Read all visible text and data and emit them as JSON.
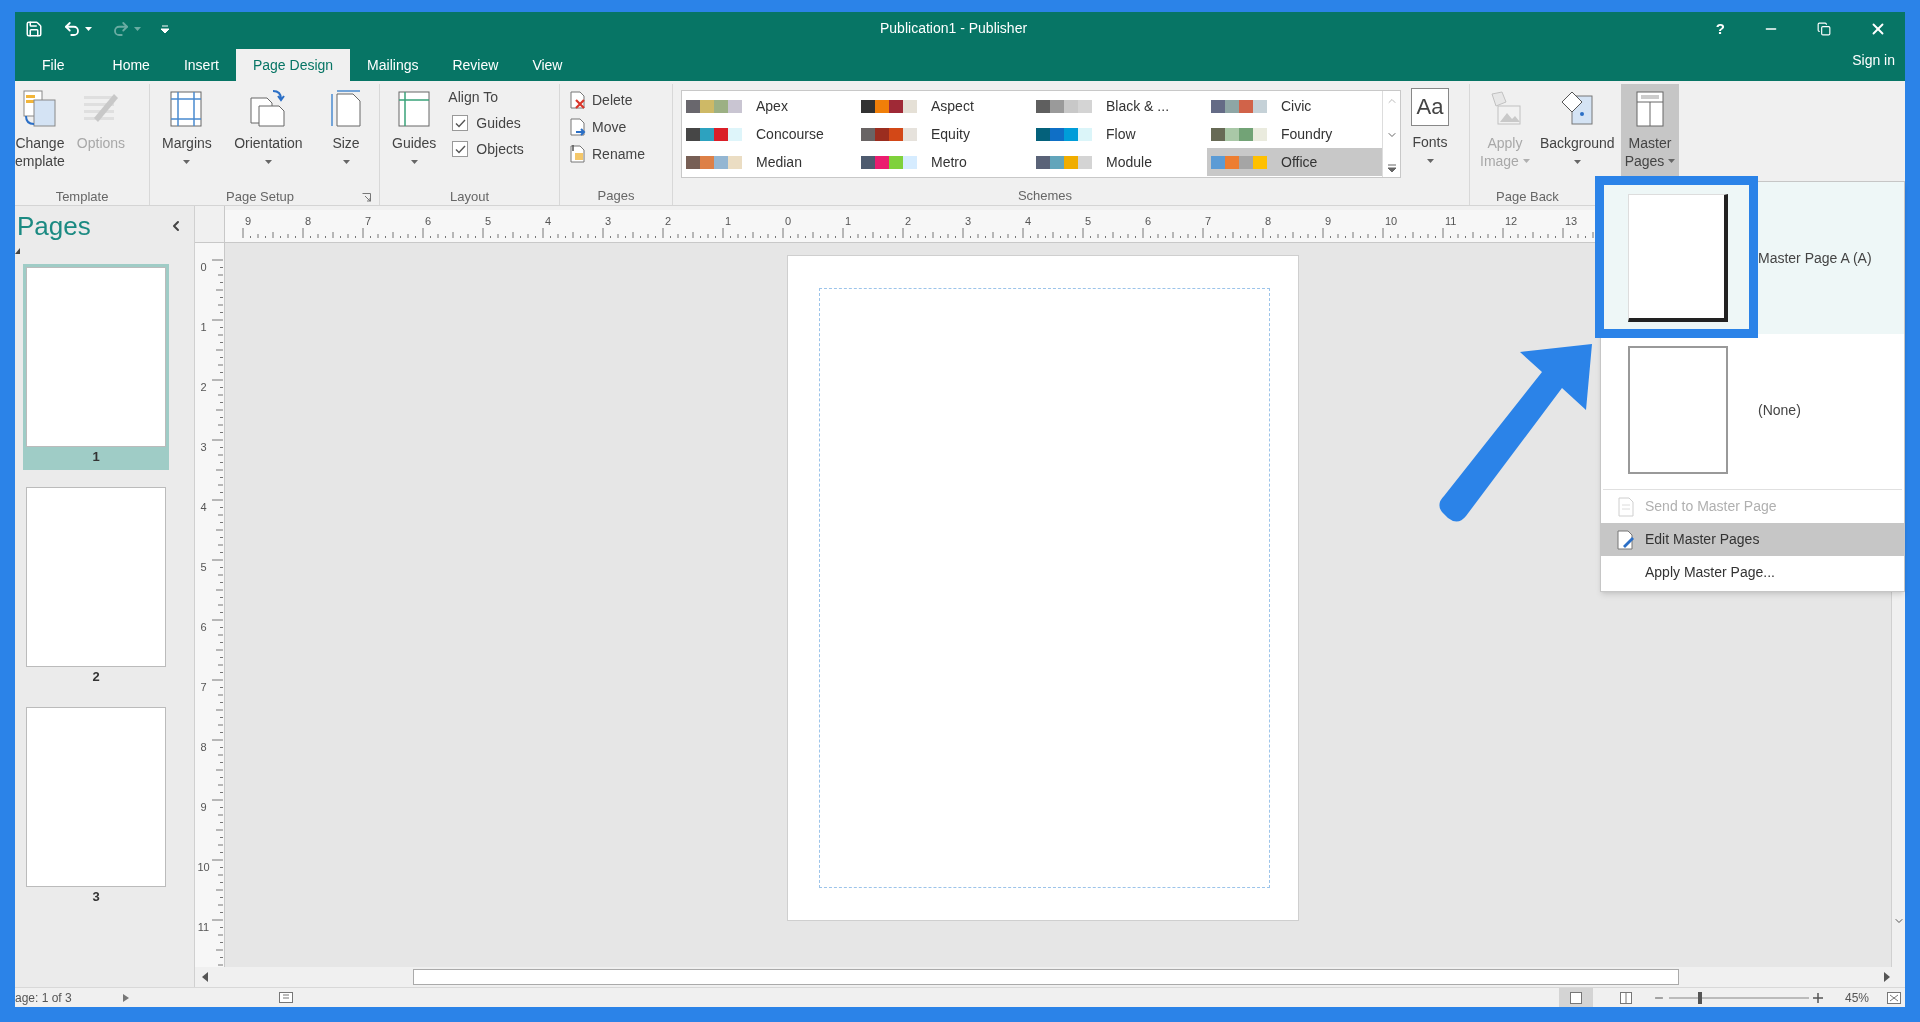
{
  "window": {
    "title": "Publication1 - Publisher",
    "help": "?"
  },
  "tabs": [
    {
      "label": "File",
      "selected": false
    },
    {
      "label": "Home",
      "selected": false
    },
    {
      "label": "Insert",
      "selected": false
    },
    {
      "label": "Page Design",
      "selected": true
    },
    {
      "label": "Mailings",
      "selected": false
    },
    {
      "label": "Review",
      "selected": false
    },
    {
      "label": "View",
      "selected": false
    }
  ],
  "sign_in": "Sign in",
  "ribbon": {
    "template": {
      "label": "Template",
      "buttons": [
        {
          "lines": [
            "Change",
            "emplate"
          ],
          "disabled": false,
          "dropdown": false
        },
        {
          "lines": [
            "Options"
          ],
          "disabled": true,
          "dropdown": false
        }
      ]
    },
    "page_setup": {
      "label": "Page Setup",
      "buttons": [
        {
          "lines": [
            "Margins"
          ],
          "disabled": false,
          "dropdown": true
        },
        {
          "lines": [
            "Orientation"
          ],
          "disabled": false,
          "dropdown": true
        },
        {
          "lines": [
            "Size"
          ],
          "disabled": false,
          "dropdown": true
        }
      ]
    },
    "layout": {
      "label": "Layout",
      "buttons": [
        {
          "lines": [
            "Guides"
          ],
          "disabled": false,
          "dropdown": true
        }
      ],
      "align_to": "Align To",
      "checks": [
        {
          "label": "Guides",
          "checked": true
        },
        {
          "label": "Objects",
          "checked": true
        }
      ]
    },
    "pages": {
      "label": "Pages",
      "buttons": [
        {
          "label": "Delete"
        },
        {
          "label": "Move"
        },
        {
          "label": "Rename"
        }
      ]
    },
    "schemes": {
      "label": "Schemes",
      "items": [
        {
          "name": "Apex",
          "selected": false,
          "swatches": [
            {
              "color": "#69676d"
            },
            {
              "color": "#ceb966"
            },
            {
              "color": "#9cb084"
            },
            {
              "color": "#c9c5d2"
            }
          ]
        },
        {
          "name": "Aspect",
          "selected": false,
          "swatches": [
            {
              "color": "#323232"
            },
            {
              "color": "#f07f09"
            },
            {
              "color": "#9f2936"
            },
            {
              "color": "#e5e0d6"
            }
          ]
        },
        {
          "name": "Black & ...",
          "selected": false,
          "swatches": [
            {
              "color": "#5f5f5f"
            },
            {
              "color": "#9a9a9a"
            },
            {
              "color": "#c8c8c8"
            },
            {
              "color": "#d4d4d4"
            }
          ]
        },
        {
          "name": "Civic",
          "selected": false,
          "swatches": [
            {
              "color": "#646b86"
            },
            {
              "color": "#8ea6a5"
            },
            {
              "color": "#d16349"
            },
            {
              "color": "#c5d1d7"
            }
          ]
        },
        {
          "name": "Concourse",
          "selected": false,
          "swatches": [
            {
              "color": "#464646"
            },
            {
              "color": "#2da2bf"
            },
            {
              "color": "#da1f28"
            },
            {
              "color": "#def5fa"
            }
          ]
        },
        {
          "name": "Equity",
          "selected": false,
          "swatches": [
            {
              "color": "#696464"
            },
            {
              "color": "#9b2d1f"
            },
            {
              "color": "#d34817"
            },
            {
              "color": "#e6e2dc"
            }
          ]
        },
        {
          "name": "Flow",
          "selected": false,
          "swatches": [
            {
              "color": "#04617b"
            },
            {
              "color": "#0f6fc6"
            },
            {
              "color": "#009dd9"
            },
            {
              "color": "#dbf5f9"
            }
          ]
        },
        {
          "name": "Foundry",
          "selected": false,
          "swatches": [
            {
              "color": "#676a55"
            },
            {
              "color": "#a9c8a7"
            },
            {
              "color": "#72a376"
            },
            {
              "color": "#eaebde"
            }
          ]
        },
        {
          "name": "Median",
          "selected": false,
          "swatches": [
            {
              "color": "#775f55"
            },
            {
              "color": "#dd8047"
            },
            {
              "color": "#94b6d2"
            },
            {
              "color": "#ebddc3"
            }
          ]
        },
        {
          "name": "Metro",
          "selected": false,
          "swatches": [
            {
              "color": "#4e5b6f"
            },
            {
              "color": "#eb1d6f"
            },
            {
              "color": "#7fd13b"
            },
            {
              "color": "#d6ecff"
            }
          ]
        },
        {
          "name": "Module",
          "selected": false,
          "swatches": [
            {
              "color": "#5a6378"
            },
            {
              "color": "#62a5bb"
            },
            {
              "color": "#f0ad00"
            },
            {
              "color": "#d4d4d4"
            }
          ]
        },
        {
          "name": "Office",
          "selected": true,
          "swatches": [
            {
              "color": "#5b9bd5"
            },
            {
              "color": "#ed7d31"
            },
            {
              "color": "#a5a5a5"
            },
            {
              "color": "#ffc000"
            }
          ]
        }
      ],
      "fonts": {
        "glyph": "Aa",
        "lines": [
          "Fonts"
        ],
        "disabled": false,
        "dropdown": true
      }
    },
    "page_background": {
      "label": "Page Back",
      "buttons": [
        {
          "lines": [
            "Apply",
            "Image"
          ],
          "disabled": true,
          "dropdown": true,
          "selected": false
        },
        {
          "lines": [
            "Background"
          ],
          "disabled": false,
          "dropdown": true,
          "selected": false
        },
        {
          "lines": [
            "Master",
            "Pages"
          ],
          "disabled": false,
          "dropdown": true,
          "selected": true
        }
      ]
    }
  },
  "pages_panel": {
    "title": "Pages",
    "pages": [
      {
        "number": "1",
        "selected": true
      },
      {
        "number": "2",
        "selected": false
      },
      {
        "number": "3",
        "selected": false
      }
    ]
  },
  "horizontal_ruler": [
    "9",
    "8",
    "7",
    "6",
    "5",
    "4",
    "3",
    "2",
    "1",
    "0",
    "1",
    "2",
    "3",
    "4",
    "5",
    "6",
    "7",
    "8",
    "9",
    "10",
    "11",
    "12",
    "13"
  ],
  "vertical_ruler": [
    "0",
    "1",
    "2",
    "3",
    "4",
    "5",
    "6",
    "7",
    "8",
    "9",
    "10",
    "11"
  ],
  "master_pages_menu": {
    "masters": [
      {
        "label": "Master Page A (A)",
        "selected": true
      },
      {
        "label": "(None)",
        "selected": false
      }
    ],
    "items": [
      {
        "label": "Send to Master Page",
        "disabled": true,
        "selected": false
      },
      {
        "label": "Edit Master Pages",
        "disabled": false,
        "selected": true
      },
      {
        "label": "Apply Master Page...",
        "disabled": false,
        "selected": false
      }
    ]
  },
  "status_bar": {
    "page_info": "age: 1 of 3",
    "zoom": {
      "level": 0.22,
      "reading": "45%"
    }
  }
}
